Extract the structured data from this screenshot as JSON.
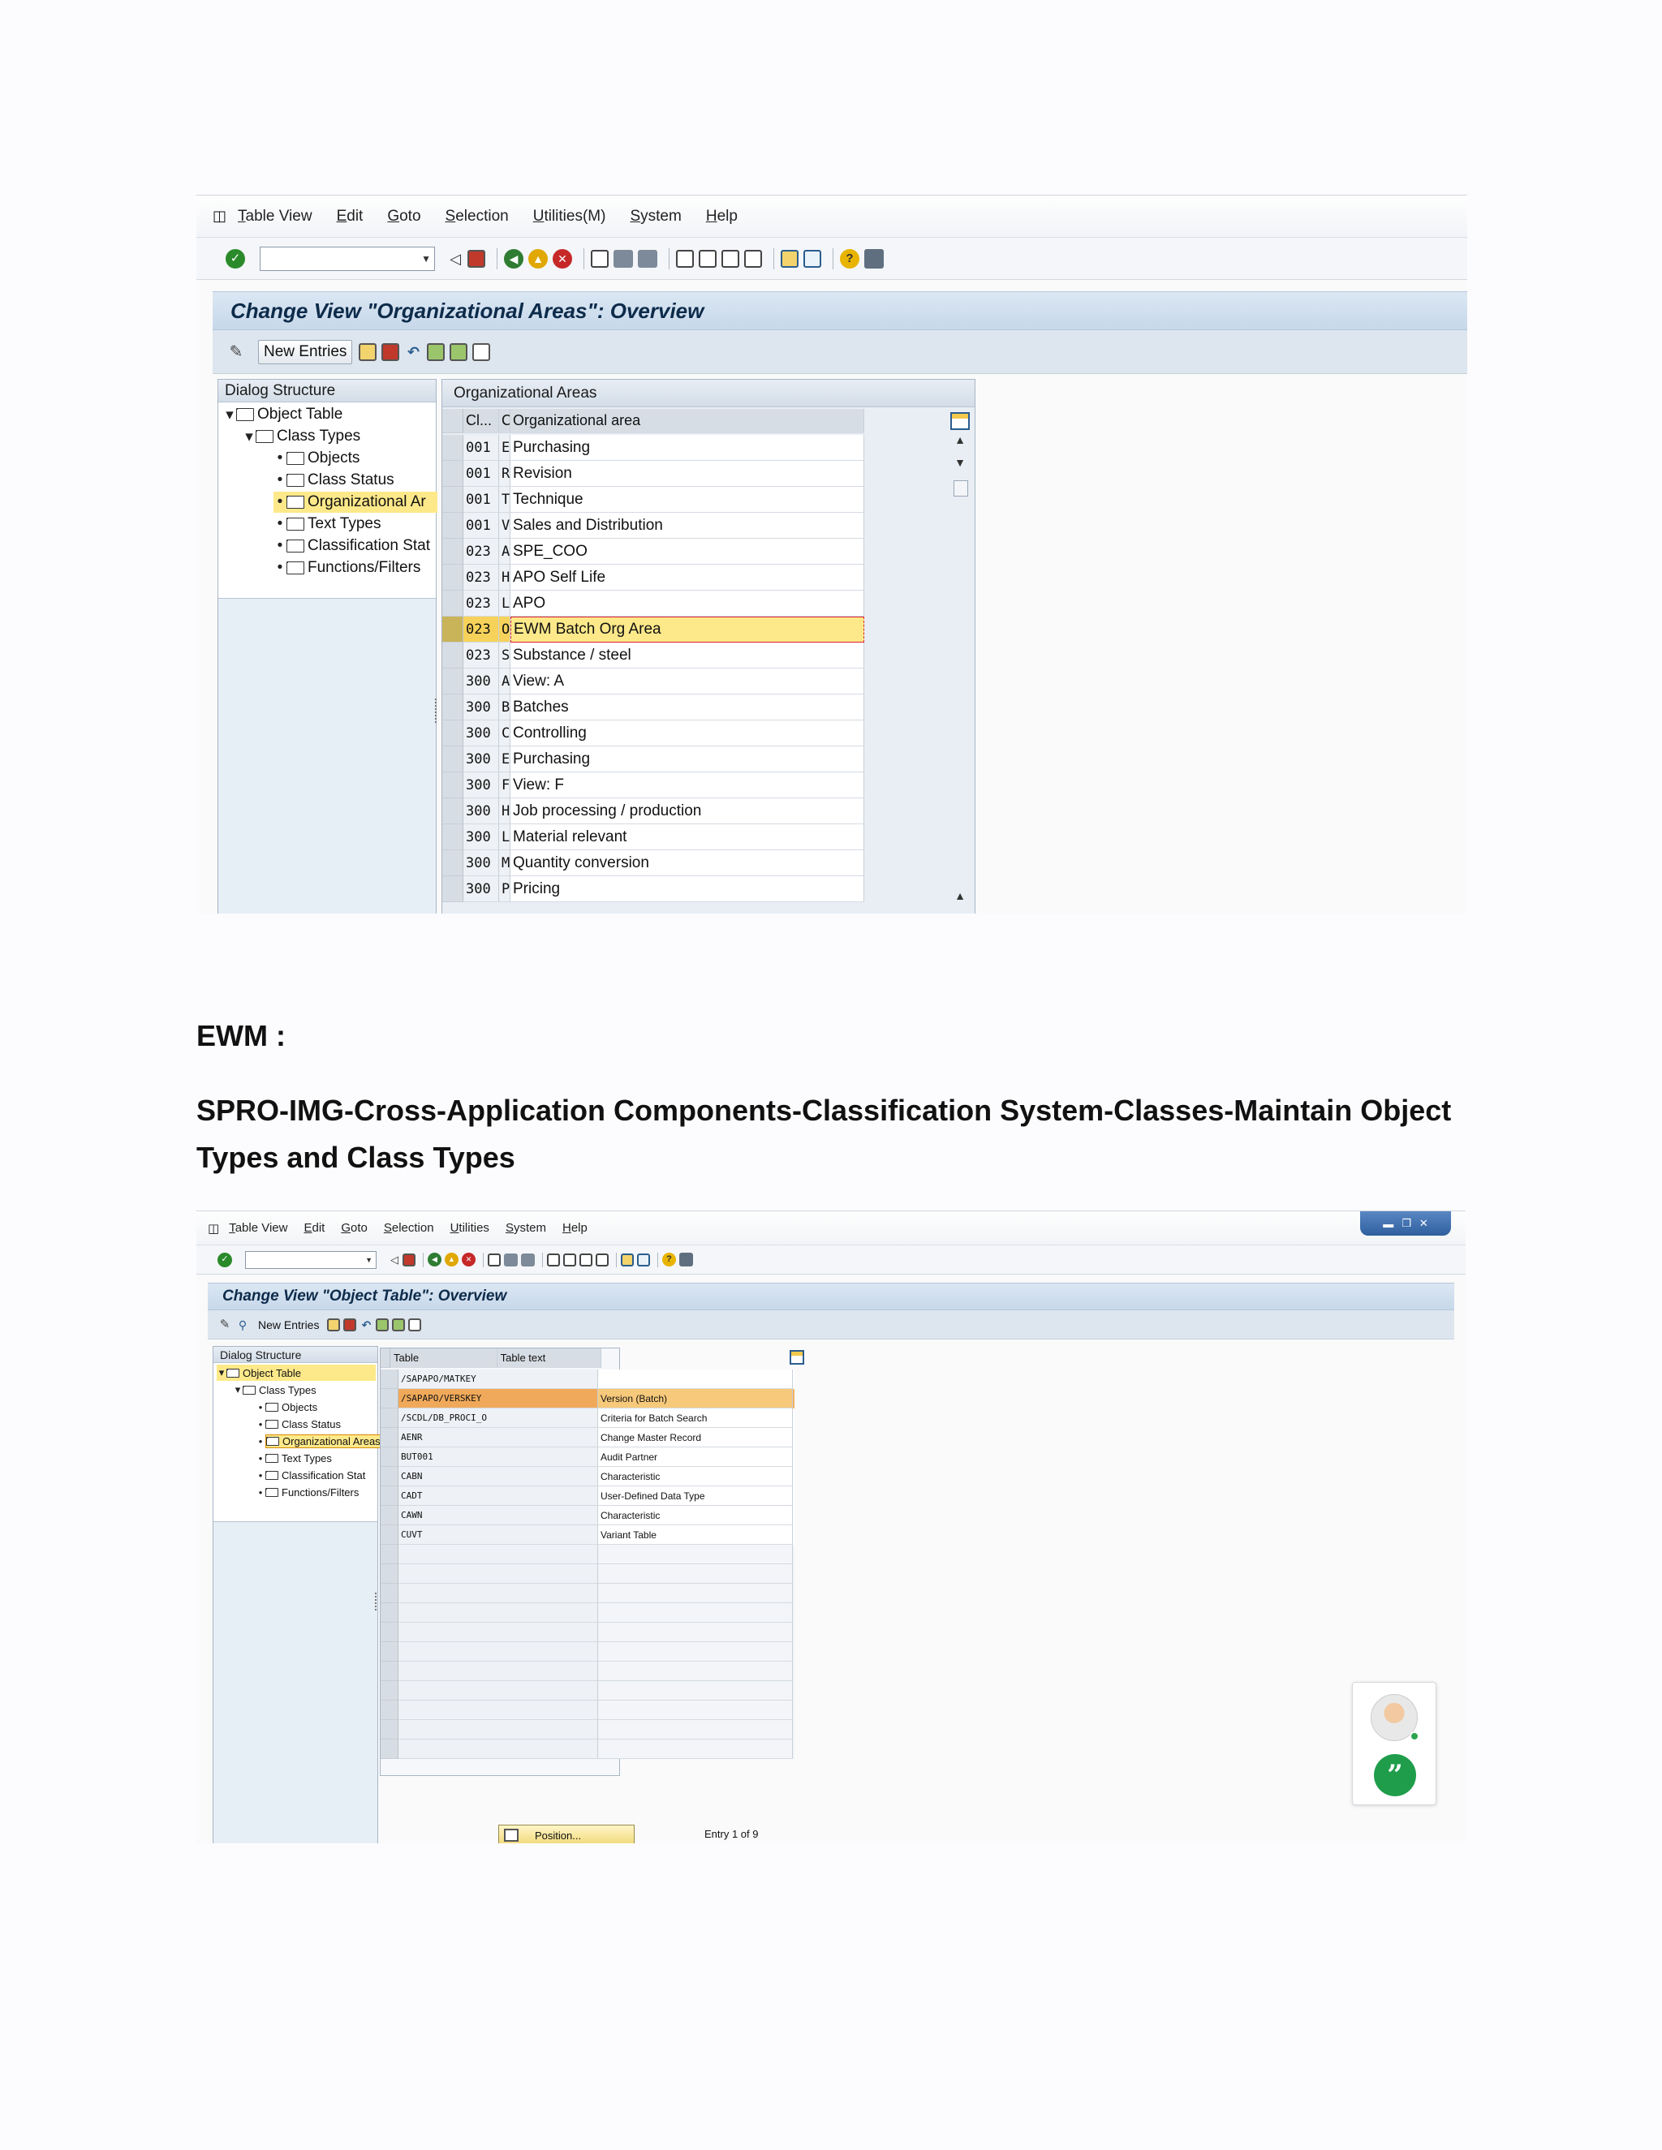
{
  "screenshot1": {
    "menu": [
      "Table View",
      "Edit",
      "Goto",
      "Selection",
      "Utilities(M)",
      "System",
      "Help"
    ],
    "title": "Change View \"Organizational Areas\": Overview",
    "new_entries": "New Entries",
    "dialog_structure": {
      "header": "Dialog Structure",
      "items": [
        "Object Table",
        "Class Types",
        "Objects",
        "Class Status",
        "Organizational Ar",
        "Text Types",
        "Classification Stat",
        "Functions/Filters"
      ]
    },
    "grid": {
      "title": "Organizational Areas",
      "headers": [
        "Cl...",
        "C",
        "Organizational area"
      ],
      "rows": [
        [
          "001",
          "E",
          "Purchasing"
        ],
        [
          "001",
          "R",
          "Revision"
        ],
        [
          "001",
          "T",
          "Technique"
        ],
        [
          "001",
          "V",
          "Sales and Distribution"
        ],
        [
          "023",
          "A",
          "SPE_COO"
        ],
        [
          "023",
          "H",
          "APO Self Life"
        ],
        [
          "023",
          "L",
          "APO"
        ],
        [
          "023",
          "O",
          "EWM Batch Org Area"
        ],
        [
          "023",
          "S",
          "Substance / steel"
        ],
        [
          "300",
          "A",
          "View: A"
        ],
        [
          "300",
          "B",
          "Batches"
        ],
        [
          "300",
          "C",
          "Controlling"
        ],
        [
          "300",
          "E",
          "Purchasing"
        ],
        [
          "300",
          "F",
          "View: F"
        ],
        [
          "300",
          "H",
          "Job processing / production"
        ],
        [
          "300",
          "L",
          "Material relevant"
        ],
        [
          "300",
          "M",
          "Quantity conversion"
        ],
        [
          "300",
          "P",
          "Pricing"
        ]
      ],
      "selected_row": 7
    }
  },
  "doc": {
    "heading": "EWM :",
    "path_line1": "SPRO-IMG-Cross-Application Components-Classification System-Classes-Maintain Object",
    "path_line2": "Types and Class Types"
  },
  "screenshot2": {
    "menu": [
      "Table View",
      "Edit",
      "Goto",
      "Selection",
      "Utilities",
      "System",
      "Help"
    ],
    "title": "Change View \"Object Table\": Overview",
    "new_entries": "New Entries",
    "dialog_structure": {
      "header": "Dialog Structure",
      "items": [
        "Object Table",
        "Class Types",
        "Objects",
        "Class Status",
        "Organizational Areas",
        "Text Types",
        "Classification Stat",
        "Functions/Filters"
      ]
    },
    "grid": {
      "headers": [
        "Table",
        "Table text"
      ],
      "rows": [
        [
          "/SAPAPO/MATKEY",
          ""
        ],
        [
          "/SAPAPO/VERSKEY",
          "Version (Batch)"
        ],
        [
          "/SCDL/DB_PROCI_O",
          "Criteria for Batch Search"
        ],
        [
          "AENR",
          "Change Master Record"
        ],
        [
          "BUT001",
          "Audit Partner"
        ],
        [
          "CABN",
          "Characteristic"
        ],
        [
          "CADT",
          "User-Defined Data Type"
        ],
        [
          "CAWN",
          "Characteristic"
        ],
        [
          "CUVT",
          "Variant Table"
        ]
      ],
      "selected_row": 1
    },
    "position_button": "Position...",
    "entry_info": "Entry 1 of 9"
  }
}
